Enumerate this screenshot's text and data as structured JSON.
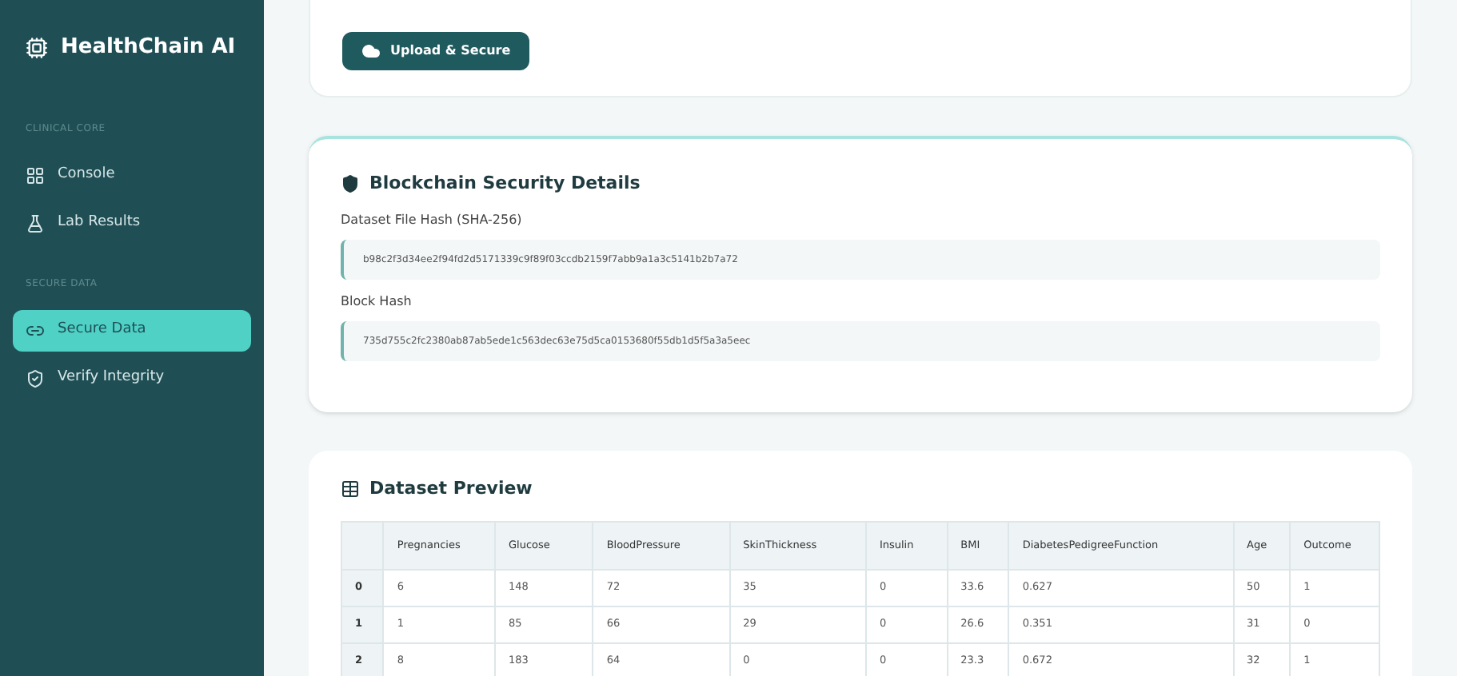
{
  "sidebar": {
    "brand": "HealthChain AI",
    "sections": [
      {
        "heading": "CLINICAL CORE",
        "items": [
          {
            "label": "Console",
            "selected": false
          },
          {
            "label": "Lab Results",
            "selected": false
          }
        ]
      },
      {
        "heading": "SECURE DATA",
        "items": [
          {
            "label": "Secure Data",
            "selected": true
          },
          {
            "label": "Verify Integrity",
            "selected": false
          }
        ]
      }
    ]
  },
  "upload": {
    "button": "Upload & Secure"
  },
  "security": {
    "title": "Blockchain Security Details",
    "fields": [
      {
        "label": "Dataset File Hash (SHA-256)",
        "value": "b98c2f3d34ee2f94fd2d5171339c9f89f03ccdb2159f7abb9a1a3c5141b2b7a72"
      },
      {
        "label": "Block Hash",
        "value": "735d755c2fc2380ab87ab5ede1c563dec63e75d5ca0153680f55db1d5f5a3a5eec"
      }
    ]
  },
  "preview": {
    "title": "Dataset Preview",
    "table": {
      "columns": [
        "",
        "Pregnancies",
        "Glucose",
        "BloodPressure",
        "SkinThickness",
        "Insulin",
        "BMI",
        "DiabetesPedigreeFunction",
        "Age",
        "Outcome"
      ],
      "rows": [
        [
          "0",
          "6",
          "148",
          "72",
          "35",
          "0",
          "33.6",
          "0.627",
          "50",
          "1"
        ],
        [
          "1",
          "1",
          "85",
          "66",
          "29",
          "0",
          "26.6",
          "0.351",
          "31",
          "0"
        ],
        [
          "2",
          "8",
          "183",
          "64",
          "0",
          "0",
          "23.3",
          "0.672",
          "32",
          "1"
        ]
      ]
    }
  }
}
